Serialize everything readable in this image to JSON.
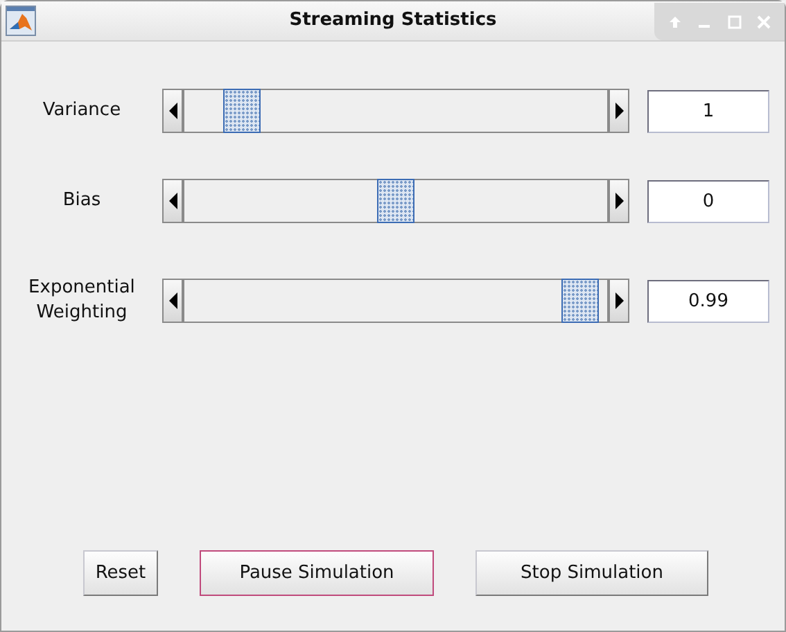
{
  "window": {
    "title": "Streaming Statistics"
  },
  "controls": [
    {
      "label": "Variance",
      "level": 0.1,
      "value": "1"
    },
    {
      "label": "Bias",
      "level": 0.5,
      "value": "0"
    },
    {
      "label": "Exponential Weighting",
      "level": 0.98,
      "value": "0.99"
    }
  ],
  "buttons": [
    {
      "label": "Reset",
      "focused": false
    },
    {
      "label": "Pause Simulation",
      "focused": true
    },
    {
      "label": "Stop Simulation",
      "focused": false
    }
  ]
}
